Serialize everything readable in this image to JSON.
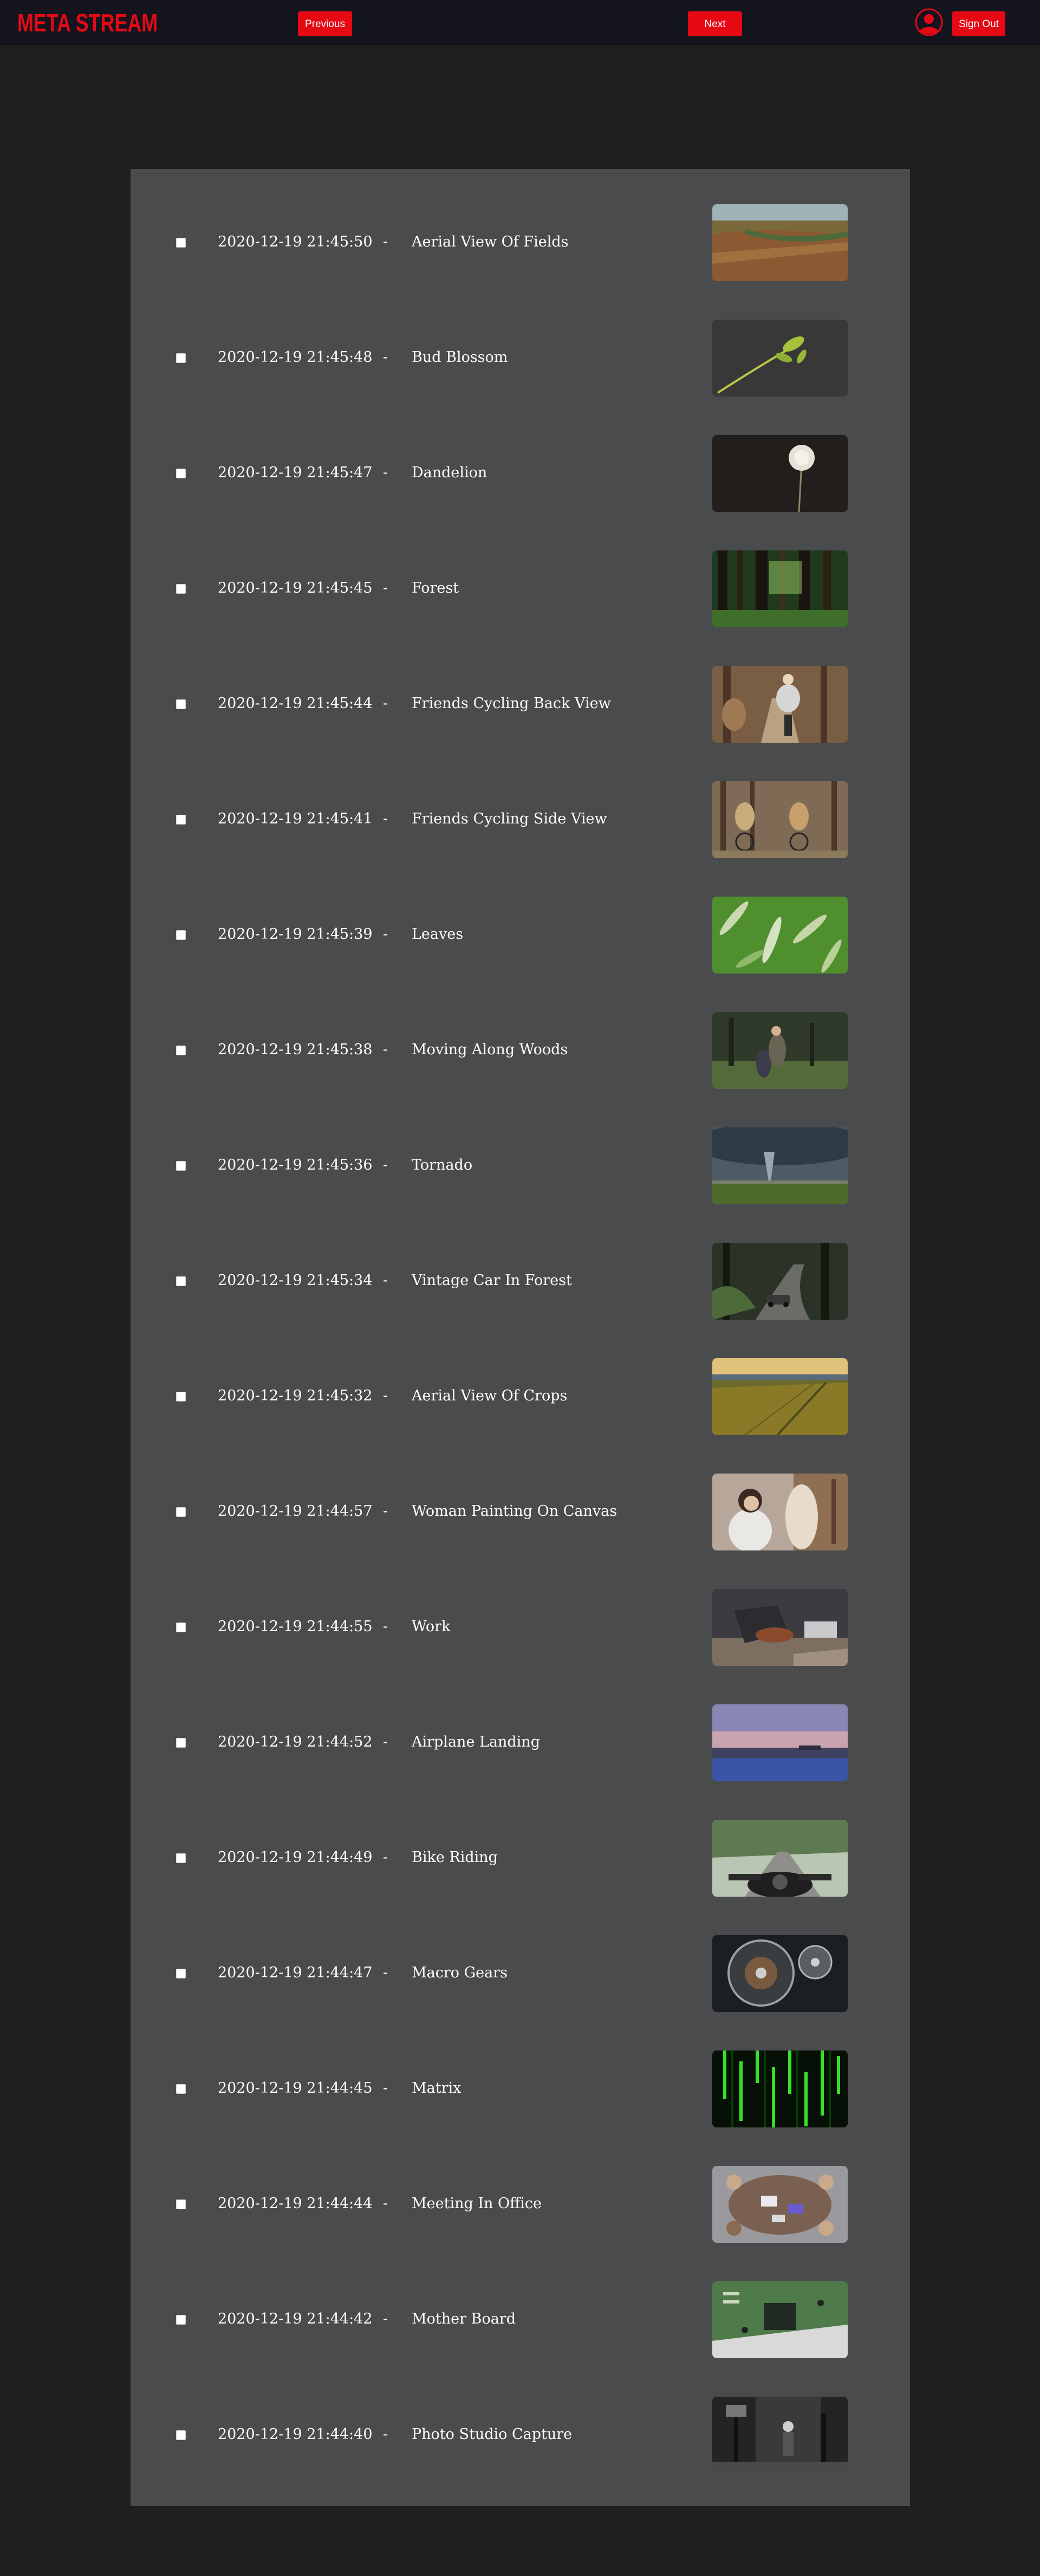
{
  "header": {
    "logo": "META STREAM",
    "previous_label": "Previous",
    "next_label": "Next",
    "signout_label": "Sign Out",
    "accent": "#e50914"
  },
  "items": [
    {
      "timestamp": "2020-12-19 21:45:50",
      "separator": "-",
      "title": "Aerial View Of Fields",
      "thumb": "aerial-fields"
    },
    {
      "timestamp": "2020-12-19 21:45:48",
      "separator": "-",
      "title": "Bud Blossom",
      "thumb": "bud-blossom"
    },
    {
      "timestamp": "2020-12-19 21:45:47",
      "separator": "-",
      "title": "Dandelion",
      "thumb": "dandelion"
    },
    {
      "timestamp": "2020-12-19 21:45:45",
      "separator": "-",
      "title": "Forest",
      "thumb": "forest"
    },
    {
      "timestamp": "2020-12-19 21:45:44",
      "separator": "-",
      "title": "Friends Cycling Back View",
      "thumb": "cycling-back"
    },
    {
      "timestamp": "2020-12-19 21:45:41",
      "separator": "-",
      "title": "Friends Cycling Side View",
      "thumb": "cycling-side"
    },
    {
      "timestamp": "2020-12-19 21:45:39",
      "separator": "-",
      "title": "Leaves",
      "thumb": "leaves"
    },
    {
      "timestamp": "2020-12-19 21:45:38",
      "separator": "-",
      "title": "Moving Along Woods",
      "thumb": "moving-woods"
    },
    {
      "timestamp": "2020-12-19 21:45:36",
      "separator": "-",
      "title": "Tornado",
      "thumb": "tornado"
    },
    {
      "timestamp": "2020-12-19 21:45:34",
      "separator": "-",
      "title": "Vintage Car In Forest",
      "thumb": "vintage-car"
    },
    {
      "timestamp": "2020-12-19 21:45:32",
      "separator": "-",
      "title": "Aerial View Of Crops",
      "thumb": "aerial-crops"
    },
    {
      "timestamp": "2020-12-19 21:44:57",
      "separator": "-",
      "title": "Woman Painting On Canvas",
      "thumb": "woman-painting"
    },
    {
      "timestamp": "2020-12-19 21:44:55",
      "separator": "-",
      "title": "Work",
      "thumb": "work"
    },
    {
      "timestamp": "2020-12-19 21:44:52",
      "separator": "-",
      "title": "Airplane Landing",
      "thumb": "airplane"
    },
    {
      "timestamp": "2020-12-19 21:44:49",
      "separator": "-",
      "title": "Bike Riding",
      "thumb": "bike-riding"
    },
    {
      "timestamp": "2020-12-19 21:44:47",
      "separator": "-",
      "title": "Macro Gears",
      "thumb": "macro-gears"
    },
    {
      "timestamp": "2020-12-19 21:44:45",
      "separator": "-",
      "title": "Matrix",
      "thumb": "matrix"
    },
    {
      "timestamp": "2020-12-19 21:44:44",
      "separator": "-",
      "title": "Meeting In Office",
      "thumb": "meeting"
    },
    {
      "timestamp": "2020-12-19 21:44:42",
      "separator": "-",
      "title": "Mother Board",
      "thumb": "motherboard"
    },
    {
      "timestamp": "2020-12-19 21:44:40",
      "separator": "-",
      "title": "Photo Studio Capture",
      "thumb": "photo-studio"
    }
  ]
}
